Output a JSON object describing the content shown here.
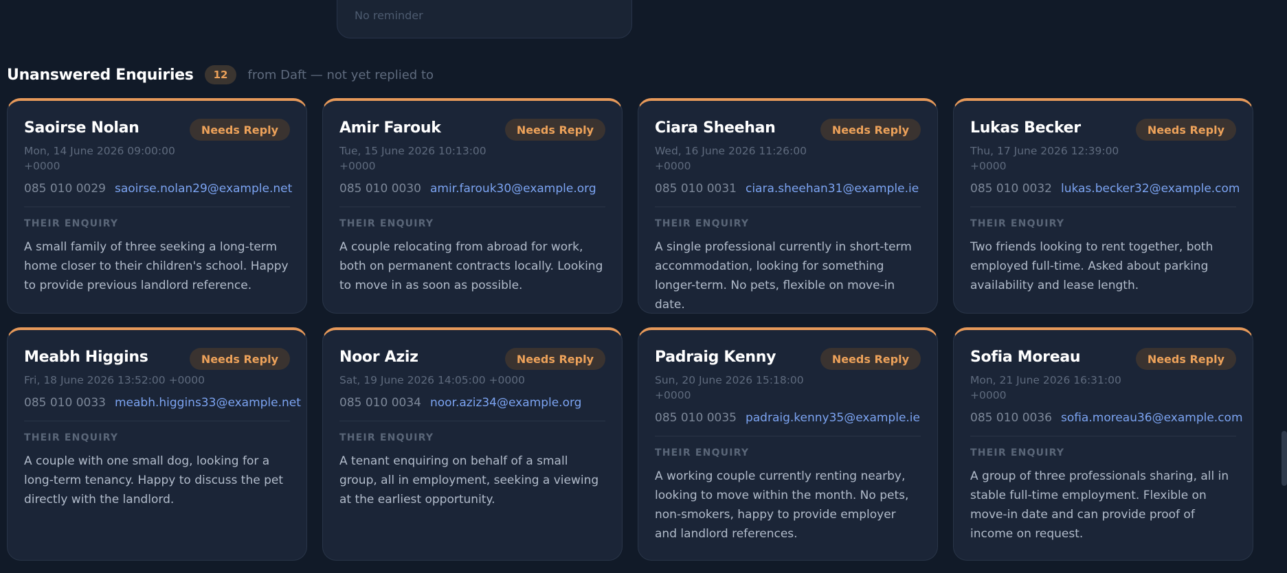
{
  "previous_card": {
    "reminder_text": "No reminder"
  },
  "section": {
    "title": "Unanswered Enquiries",
    "count": "12",
    "subtitle": "from Daft — not yet replied to"
  },
  "labels": {
    "enquiry_heading": "THEIR ENQUIRY"
  },
  "colors": {
    "accent": "#e6995a",
    "badge_text": "#eda25a",
    "link": "#7ca4f2",
    "background": "#111a28",
    "card": "#1b2537"
  },
  "enquiries": [
    {
      "name": "Saoirse Nolan",
      "status": "Needs Reply",
      "date": "Mon, 14 June 2026 09:00:00 +0000",
      "phone": "085 010 0029",
      "email": "saoirse.nolan29@example.net",
      "enquiry": "A small family of three seeking a long-term home closer to their children's school. Happy to provide previous landlord reference."
    },
    {
      "name": "Amir Farouk",
      "status": "Needs Reply",
      "date": "Tue, 15 June 2026 10:13:00 +0000",
      "phone": "085 010 0030",
      "email": "amir.farouk30@example.org",
      "enquiry": "A couple relocating from abroad for work, both on permanent contracts locally. Looking to move in as soon as possible."
    },
    {
      "name": "Ciara Sheehan",
      "status": "Needs Reply",
      "date": "Wed, 16 June 2026 11:26:00 +0000",
      "phone": "085 010 0031",
      "email": "ciara.sheehan31@example.ie",
      "enquiry": "A single professional currently in short-term accommodation, looking for something longer-term. No pets, flexible on move-in date."
    },
    {
      "name": "Lukas Becker",
      "status": "Needs Reply",
      "date": "Thu, 17 June 2026 12:39:00 +0000",
      "phone": "085 010 0032",
      "email": "lukas.becker32@example.com",
      "enquiry": "Two friends looking to rent together, both employed full-time. Asked about parking availability and lease length."
    },
    {
      "name": "Meabh Higgins",
      "status": "Needs Reply",
      "date": "Fri, 18 June 2026 13:52:00 +0000",
      "phone": "085 010 0033",
      "email": "meabh.higgins33@example.net",
      "enquiry": "A couple with one small dog, looking for a long-term tenancy. Happy to discuss the pet directly with the landlord."
    },
    {
      "name": "Noor Aziz",
      "status": "Needs Reply",
      "date": "Sat, 19 June 2026 14:05:00 +0000",
      "phone": "085 010 0034",
      "email": "noor.aziz34@example.org",
      "enquiry": "A tenant enquiring on behalf of a small group, all in employment, seeking a viewing at the earliest opportunity."
    },
    {
      "name": "Padraig Kenny",
      "status": "Needs Reply",
      "date": "Sun, 20 June 2026 15:18:00 +0000",
      "phone": "085 010 0035",
      "email": "padraig.kenny35@example.ie",
      "enquiry": "A working couple currently renting nearby, looking to move within the month. No pets, non-smokers, happy to provide employer and landlord references."
    },
    {
      "name": "Sofia Moreau",
      "status": "Needs Reply",
      "date": "Mon, 21 June 2026 16:31:00 +0000",
      "phone": "085 010 0036",
      "email": "sofia.moreau36@example.com",
      "enquiry": "A group of three professionals sharing, all in stable full-time employment. Flexible on move-in date and can provide proof of income on request."
    }
  ]
}
